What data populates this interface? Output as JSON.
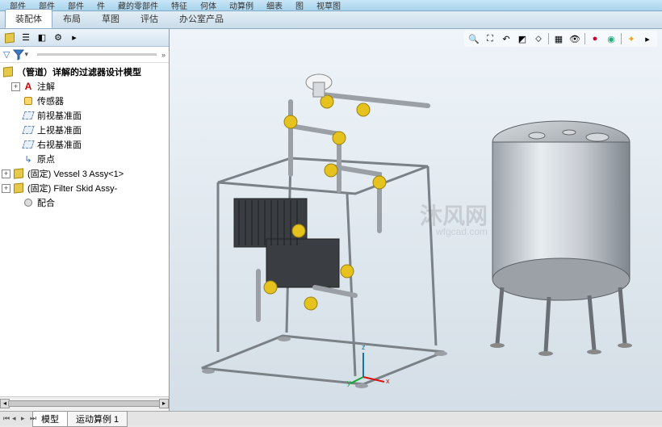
{
  "ribbon": {
    "chunks": [
      "部件",
      "部件",
      "部件",
      "件",
      "藏的零部件",
      "特征",
      "何体",
      "动算例",
      "细表",
      "图",
      "视草图"
    ]
  },
  "tabs": {
    "items": [
      "装配体",
      "布局",
      "草图",
      "评估",
      "办公室产品"
    ],
    "active_index": 0
  },
  "tree_toolbar": {
    "icons": [
      "assembly-icon",
      "display-icon",
      "cube-icon",
      "config-icon",
      "search-icon"
    ]
  },
  "tree": {
    "root": "（管道）详解的过滤器设计模型",
    "nodes": [
      {
        "label": "注解",
        "icon": "annot",
        "expander": "+",
        "indent": 1
      },
      {
        "label": "传感器",
        "icon": "sensor",
        "expander": "",
        "indent": 1
      },
      {
        "label": "前视基准面",
        "icon": "plane",
        "expander": "",
        "indent": 1
      },
      {
        "label": "上视基准面",
        "icon": "plane",
        "expander": "",
        "indent": 1
      },
      {
        "label": "右视基准面",
        "icon": "plane",
        "expander": "",
        "indent": 1
      },
      {
        "label": "原点",
        "icon": "origin",
        "expander": "",
        "indent": 1
      },
      {
        "label": "(固定) Vessel 3 Assy<1>",
        "icon": "subasm",
        "expander": "+",
        "indent": 0
      },
      {
        "label": "(固定) Filter Skid Assy-",
        "icon": "subasm",
        "expander": "+",
        "indent": 0
      },
      {
        "label": "配合",
        "icon": "mate",
        "expander": "",
        "indent": 1
      }
    ]
  },
  "viewport_toolbar": {
    "items": [
      "zoom-fit",
      "zoom-area",
      "prev-view",
      "section",
      "display-style",
      "sep",
      "view-orient",
      "scene",
      "sep",
      "render",
      "sep",
      "play"
    ]
  },
  "triad": {
    "x": "x",
    "y": "y",
    "z": "z"
  },
  "watermark": {
    "main": "沐风网",
    "sub": "wfgcad.com"
  },
  "bottom_tabs": {
    "items": [
      "模型",
      "运动算例 1"
    ],
    "active_index": 0
  }
}
